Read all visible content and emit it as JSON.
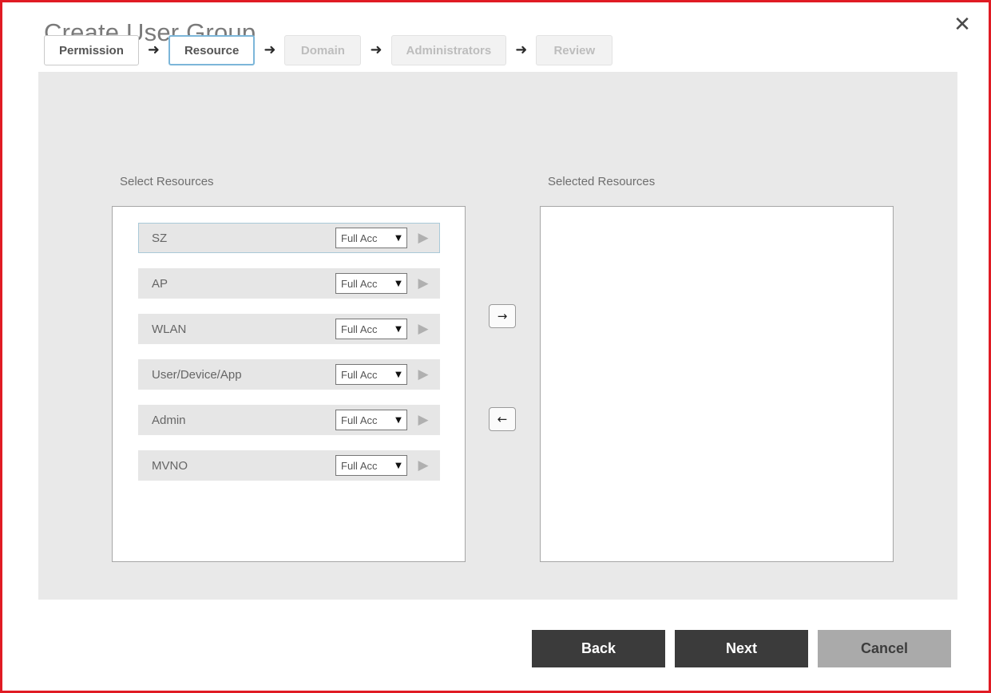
{
  "dialog": {
    "title": "Create User Group",
    "close_label": "✕"
  },
  "wizard": {
    "arrow": "➜",
    "steps": [
      {
        "label": "Permission",
        "state": "done"
      },
      {
        "label": "Resource",
        "state": "active"
      },
      {
        "label": "Domain",
        "state": "disabled"
      },
      {
        "label": "Administrators",
        "state": "disabled"
      },
      {
        "label": "Review",
        "state": "disabled"
      }
    ]
  },
  "transfer": {
    "left_label": "Select Resources",
    "right_label": "Selected Resources",
    "move_right_icon": "→",
    "move_left_icon": "←",
    "row_go_icon": "▶",
    "select_caret": "▼",
    "available": [
      {
        "name": "SZ",
        "access": "Full Acc",
        "selected": true
      },
      {
        "name": "AP",
        "access": "Full Acc",
        "selected": false
      },
      {
        "name": "WLAN",
        "access": "Full Acc",
        "selected": false
      },
      {
        "name": "User/Device/App",
        "access": "Full Acc",
        "selected": false
      },
      {
        "name": "Admin",
        "access": "Full Acc",
        "selected": false
      },
      {
        "name": "MVNO",
        "access": "Full Acc",
        "selected": false
      }
    ],
    "selected_resources": []
  },
  "footer": {
    "back_label": "Back",
    "next_label": "Next",
    "cancel_label": "Cancel"
  },
  "colors": {
    "accent_border": "#e01b24",
    "active_step": "#7cb6d9",
    "panel_bg": "#e9e9e9",
    "button_dark": "#3b3b3b",
    "button_gray": "#aaaaaa"
  }
}
